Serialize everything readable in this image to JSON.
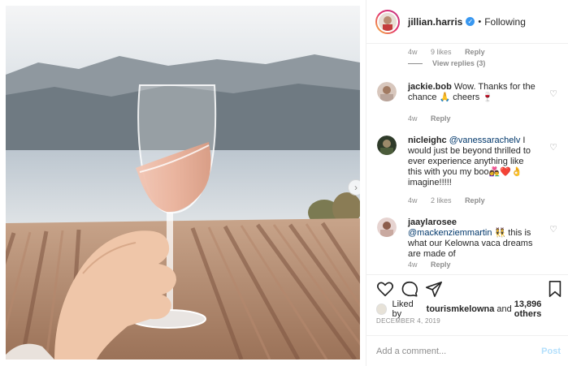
{
  "post": {
    "image_alt": "hand holding a glass of rosé wine over a vineyard and lake"
  },
  "header": {
    "username": "jillian.harris",
    "verified_icon": "verified-badge-icon",
    "separator": "•",
    "follow_status": "Following"
  },
  "comments": [
    {
      "id": "top-meta",
      "time": "4w",
      "likes": "9 likes",
      "reply": "Reply",
      "view_replies": "View replies (3)"
    },
    {
      "user": "jackie.bob",
      "text": " Wow. Thanks for the chance 🙏 cheers 🍷",
      "time": "4w",
      "reply": "Reply"
    },
    {
      "user": "nicleighc",
      "mention": "@vanessarachelv",
      "text": " I would just be beyond thrilled to ever experience anything like this with you my boo👩‍❤️‍👨❤️👌 imagine!!!!!",
      "time": "4w",
      "likes": "2 likes",
      "reply": "Reply"
    },
    {
      "user": "jaaylarosee",
      "mention": "@mackenziemmartin",
      "text": " 👯 this is what our Kelowna vaca dreams are made of",
      "time": "4w",
      "reply": "Reply"
    }
  ],
  "actions": {
    "like_icon": "heart-icon",
    "comment_icon": "comment-icon",
    "share_icon": "share-icon",
    "save_icon": "bookmark-icon"
  },
  "likes": {
    "prefix": "Liked by ",
    "first_user": "tourismkelowna",
    "and": " and ",
    "others": "13,896 others"
  },
  "date": "DECEMBER 4, 2019",
  "add_comment": {
    "placeholder": "Add a comment...",
    "post_label": "Post"
  },
  "colors": {
    "link": "#00376b",
    "verified": "#3897f0",
    "post_disabled": "#b2dffc"
  }
}
